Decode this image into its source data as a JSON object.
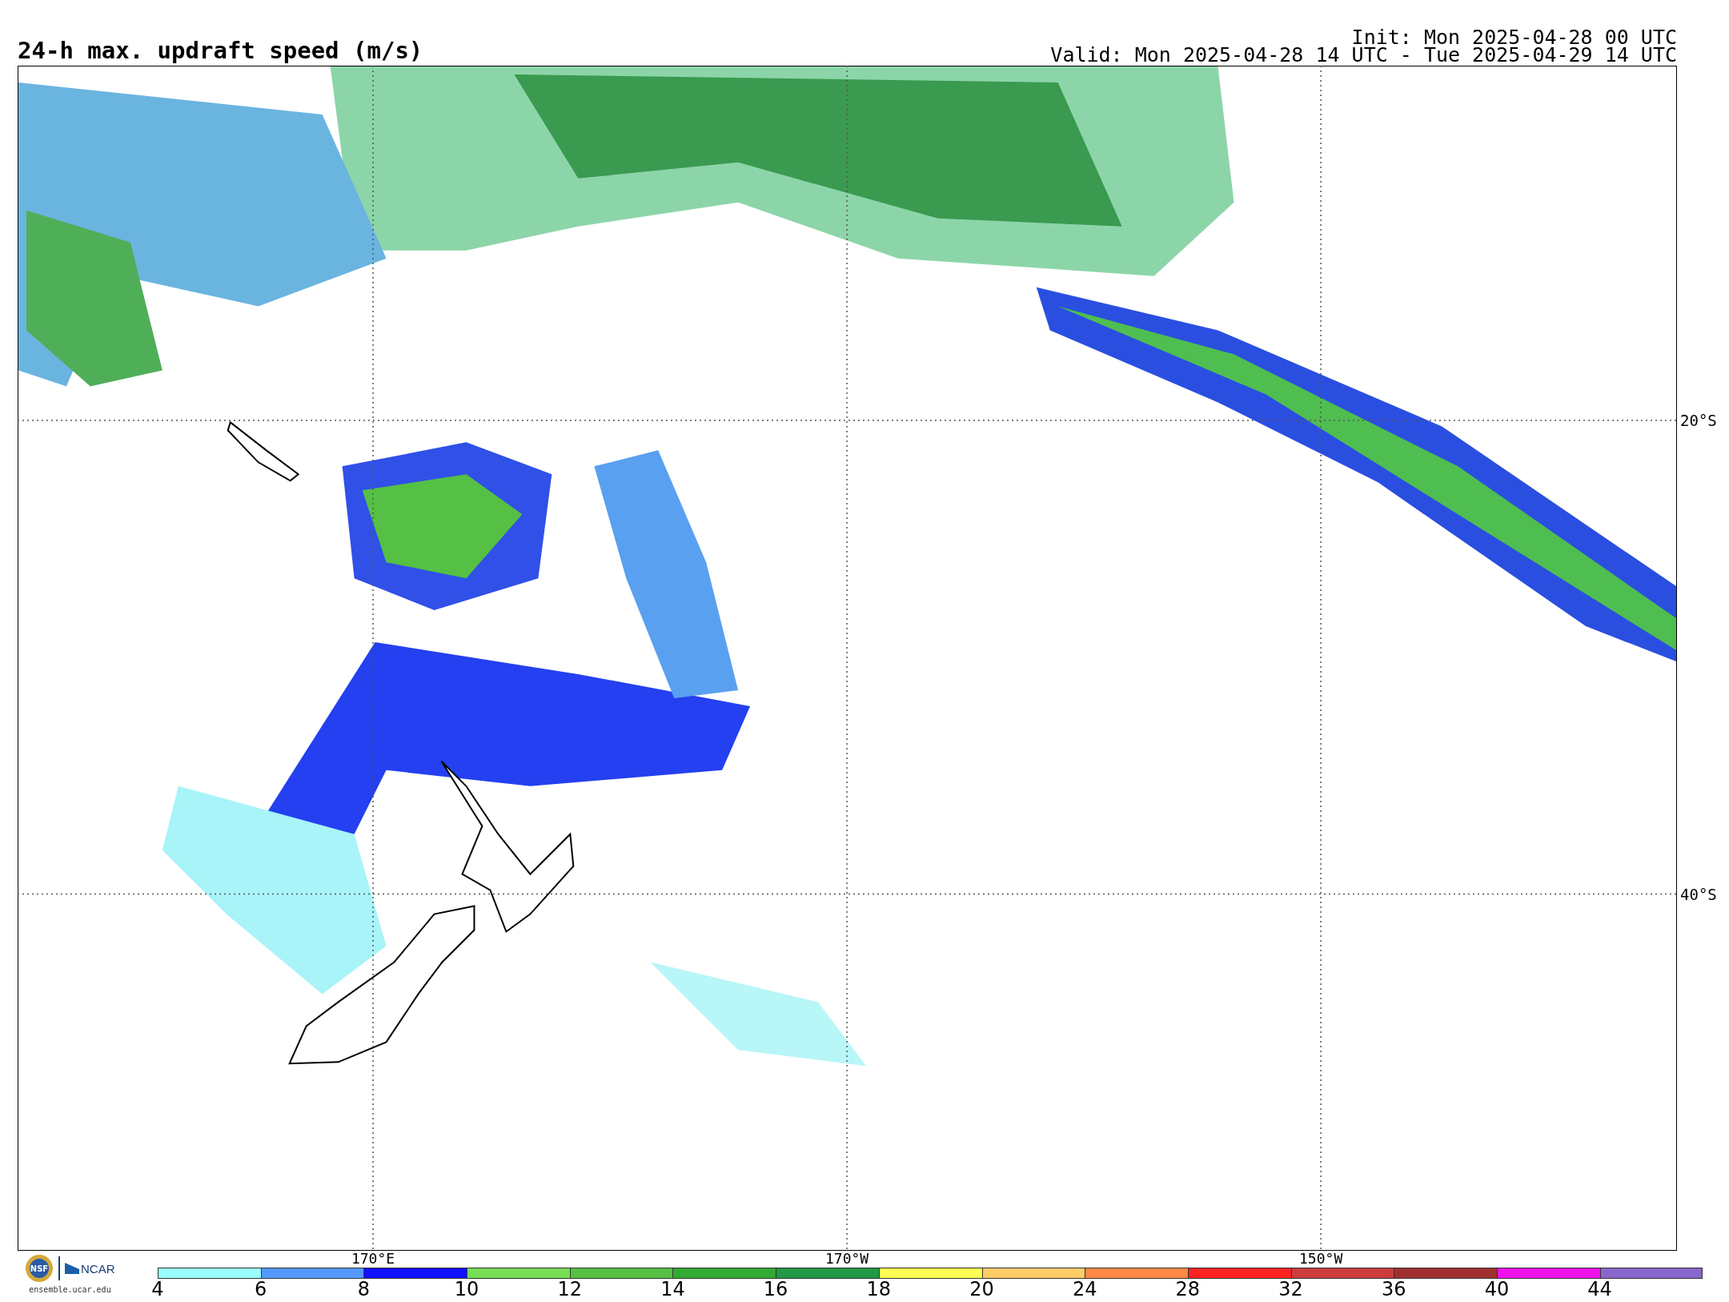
{
  "title": "24-h max. updraft speed (m/s)",
  "init": "Init: Mon 2025-04-28 00 UTC",
  "valid": "Valid: Mon 2025-04-28 14 UTC - Tue 2025-04-29 14 UTC",
  "latitude_labels": [
    "20°S",
    "40°S"
  ],
  "longitude_labels": [
    "170°E",
    "170°W",
    "150°W"
  ],
  "logos": {
    "nsf": "NSF",
    "ncar": "NCAR",
    "url": "ensemble.ucar.edu"
  },
  "colorbar": [
    {
      "label": "4",
      "color": "#99ffff"
    },
    {
      "label": "6",
      "color": "#5599ff"
    },
    {
      "label": "8",
      "color": "#1111ff"
    },
    {
      "label": "10",
      "color": "#77dd55"
    },
    {
      "label": "12",
      "color": "#55c044"
    },
    {
      "label": "14",
      "color": "#33aa33"
    },
    {
      "label": "16",
      "color": "#229944"
    },
    {
      "label": "18",
      "color": "#ffff55"
    },
    {
      "label": "20",
      "color": "#ffcc66"
    },
    {
      "label": "24",
      "color": "#ff8844"
    },
    {
      "label": "28",
      "color": "#ff2222"
    },
    {
      "label": "32",
      "color": "#cc3c3c"
    },
    {
      "label": "36",
      "color": "#a03030"
    },
    {
      "label": "40",
      "color": "#ee11ee"
    },
    {
      "label": "44",
      "color": "#8866cc"
    }
  ]
}
